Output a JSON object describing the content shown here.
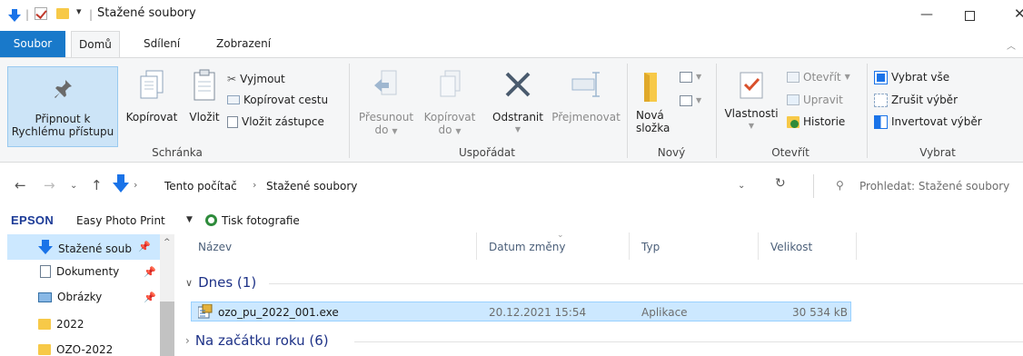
{
  "window": {
    "title": "Stažené soubory",
    "minimize_glyph": "—",
    "maximize_glyph": "☐",
    "close_glyph": "✕"
  },
  "ribbon_tabs": [
    "Soubor",
    "Domů",
    "Sdílení",
    "Zobrazení"
  ],
  "ribbon": {
    "clipboard": {
      "pin_line1": "Připnout k",
      "pin_line2": "Rychlému přístupu",
      "copy": "Kopírovat",
      "paste": "Vložit",
      "cut": "Vyjmout",
      "copy_path": "Kopírovat cestu",
      "paste_shortcut": "Vložit zástupce",
      "label": "Schránka"
    },
    "organize": {
      "move_line1": "Přesunout",
      "move_line2": "do",
      "copy_line1": "Kopírovat",
      "copy_line2": "do",
      "delete": "Odstranit",
      "rename": "Přejmenovat",
      "label": "Uspořádat"
    },
    "new": {
      "folder_line1": "Nová",
      "folder_line2": "složka",
      "label": "Nový"
    },
    "open": {
      "properties": "Vlastnosti",
      "open": "Otevřít",
      "edit": "Upravit",
      "history": "Historie",
      "label": "Otevřít"
    },
    "select": {
      "select_all": "Vybrat vše",
      "select_none": "Zrušit výběr",
      "invert": "Invertovat výběr",
      "label": "Vybrat"
    }
  },
  "address": {
    "crumbs": [
      "Tento počítač",
      "Stažené soubory"
    ],
    "search_placeholder": "Prohledat: Stažené soubory"
  },
  "epson": {
    "brand": "EPSON",
    "app": "Easy Photo Print",
    "print_photos": "Tisk fotografie"
  },
  "nav_pane": {
    "items": [
      {
        "label": "Stažené soub",
        "icon": "download-icon",
        "pinned": true
      },
      {
        "label": "Dokumenty",
        "icon": "documents-icon",
        "pinned": true
      },
      {
        "label": "Obrázky",
        "icon": "pictures-icon",
        "pinned": true
      },
      {
        "label": "2022",
        "icon": "folder-icon",
        "pinned": false
      },
      {
        "label": "OZO-2022",
        "icon": "folder-icon",
        "pinned": false
      }
    ]
  },
  "file_list": {
    "columns": [
      "Název",
      "Datum změny",
      "Typ",
      "Velikost"
    ],
    "groups": [
      {
        "header": "Dnes (1)",
        "expanded": true,
        "rows": [
          {
            "name": "ozo_pu_2022_001.exe",
            "date": "20.12.2021 15:54",
            "type": "Aplikace",
            "size": "30 534 kB"
          }
        ]
      },
      {
        "header": "Na začátku roku (6)",
        "expanded": false,
        "rows": []
      }
    ]
  },
  "colors": {
    "accent": "#1979ca",
    "selection": "#cce8ff",
    "group_header": "#1e3287",
    "epson_blue": "#1b3a96"
  }
}
